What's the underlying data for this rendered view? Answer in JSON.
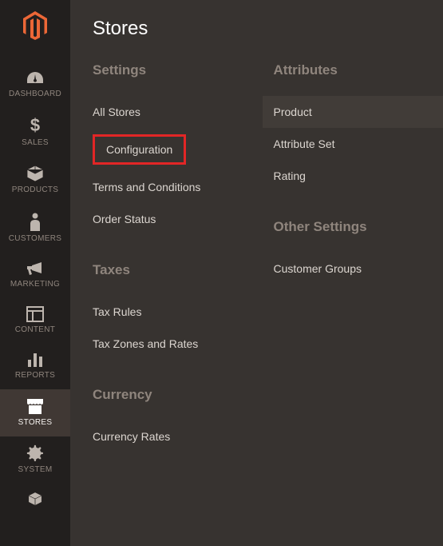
{
  "sidebar": {
    "items": [
      {
        "label": "DASHBOARD",
        "icon": "dashboard"
      },
      {
        "label": "SALES",
        "icon": "dollar"
      },
      {
        "label": "PRODUCTS",
        "icon": "box"
      },
      {
        "label": "CUSTOMERS",
        "icon": "person"
      },
      {
        "label": "MARKETING",
        "icon": "megaphone"
      },
      {
        "label": "CONTENT",
        "icon": "layout"
      },
      {
        "label": "REPORTS",
        "icon": "bars"
      },
      {
        "label": "STORES",
        "icon": "storefront",
        "active": true
      },
      {
        "label": "SYSTEM",
        "icon": "gear"
      },
      {
        "label": "",
        "icon": "cube"
      }
    ]
  },
  "panel": {
    "title": "Stores",
    "left": {
      "settings": {
        "heading": "Settings",
        "items": {
          "all_stores": "All Stores",
          "configuration": "Configuration",
          "terms": "Terms and Conditions",
          "order_status": "Order Status"
        }
      },
      "taxes": {
        "heading": "Taxes",
        "items": {
          "tax_rules": "Tax Rules",
          "tax_zones": "Tax Zones and Rates"
        }
      },
      "currency": {
        "heading": "Currency",
        "items": {
          "currency_rates": "Currency Rates"
        }
      }
    },
    "right": {
      "attributes": {
        "heading": "Attributes",
        "items": {
          "product": "Product",
          "attribute_set": "Attribute Set",
          "rating": "Rating"
        }
      },
      "other": {
        "heading": "Other Settings",
        "items": {
          "customer_groups": "Customer Groups"
        }
      }
    }
  }
}
